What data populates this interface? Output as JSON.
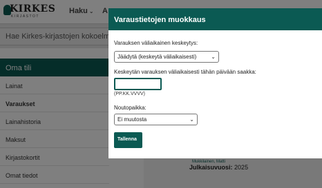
{
  "header": {
    "logo_text": "KIRKES",
    "logo_subtitle": "KIRJASTOT",
    "nav_haku": "Haku",
    "nav_partial": "A"
  },
  "search": {
    "placeholder": "Hae Kirkes-kirjastojen kokoelmi"
  },
  "sidebar": {
    "heading": "Oma tili",
    "items": [
      {
        "label": "Lainat"
      },
      {
        "label": "Varaukset"
      },
      {
        "label": "Lainahistoria"
      },
      {
        "label": "Maksut"
      },
      {
        "label": "Kirjastokortit"
      },
      {
        "label": "Omat tiedot"
      }
    ]
  },
  "record": {
    "author": "Mukkilainen, Matti",
    "year_label": "Julkaisuvuosi:",
    "year_value": "2025"
  },
  "modal": {
    "title": "Varaustietojen muokkaus",
    "pause_label": "Varauksen väliaikainen keskeytys:",
    "pause_value": "Jäädytä (keskeytä väliaikaisesti)",
    "date_label": "Keskeytän varauksen väliaikaisesti tähän päivään saakka:",
    "date_value": "",
    "date_hint": "(PP.KK.VVVV)",
    "pickup_label": "Noutopaikka:",
    "pickup_value": "Ei muutosta",
    "save_label": "Tallenna"
  },
  "colors": {
    "brand": "#0b5a53",
    "overlay": "rgba(0,0,0,0.5)"
  }
}
